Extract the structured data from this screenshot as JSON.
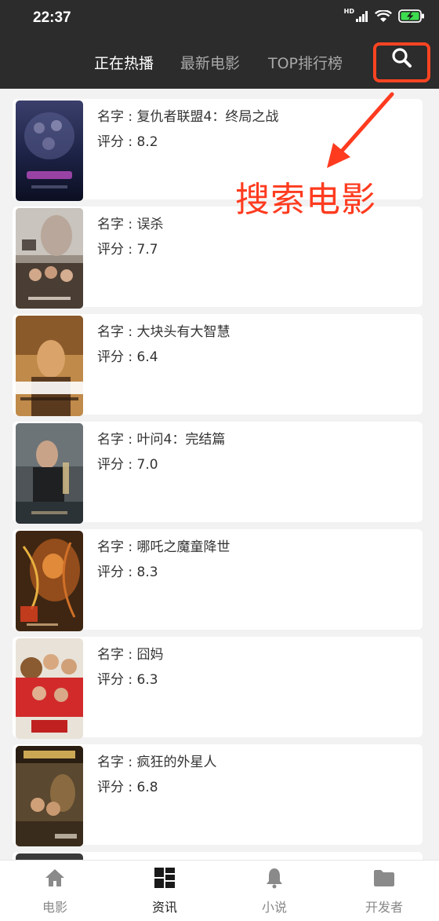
{
  "status_bar": {
    "time": "22:37",
    "network_label": "HD"
  },
  "top_tabs": [
    {
      "label": "正在热播",
      "active": true
    },
    {
      "label": "最新电影",
      "active": false
    },
    {
      "label": "TOP排行榜",
      "active": false
    }
  ],
  "annotation": {
    "text": "搜索电影",
    "color": "#ff3b1f"
  },
  "movies": [
    {
      "name_label": "名字 : ",
      "name": "复仇者联盟4：终局之战",
      "rating_label": "评分 : ",
      "rating": "8.2"
    },
    {
      "name_label": "名字 : ",
      "name": "误杀",
      "rating_label": "评分 : ",
      "rating": "7.7"
    },
    {
      "name_label": "名字 : ",
      "name": "大块头有大智慧",
      "rating_label": "评分 : ",
      "rating": "6.4"
    },
    {
      "name_label": "名字 : ",
      "name": "叶问4：完结篇",
      "rating_label": "评分 : ",
      "rating": "7.0"
    },
    {
      "name_label": "名字 : ",
      "name": "哪吒之魔童降世",
      "rating_label": "评分 : ",
      "rating": "8.3"
    },
    {
      "name_label": "名字 : ",
      "name": "囧妈",
      "rating_label": "评分 : ",
      "rating": "6.3"
    },
    {
      "name_label": "名字 : ",
      "name": "疯狂的外星人",
      "rating_label": "评分 : ",
      "rating": "6.8"
    }
  ],
  "bottom_nav": [
    {
      "label": "电影",
      "icon": "home-icon",
      "active": false
    },
    {
      "label": "资讯",
      "icon": "grid-icon",
      "active": true
    },
    {
      "label": "小说",
      "icon": "bell-icon",
      "active": false
    },
    {
      "label": "开发者",
      "icon": "folder-icon",
      "active": false
    }
  ],
  "colors": {
    "header_bg": "#2c2c2c",
    "accent_red": "#ff4422",
    "active_tab": "#ffffff",
    "inactive_tab": "#a8a8a8"
  }
}
